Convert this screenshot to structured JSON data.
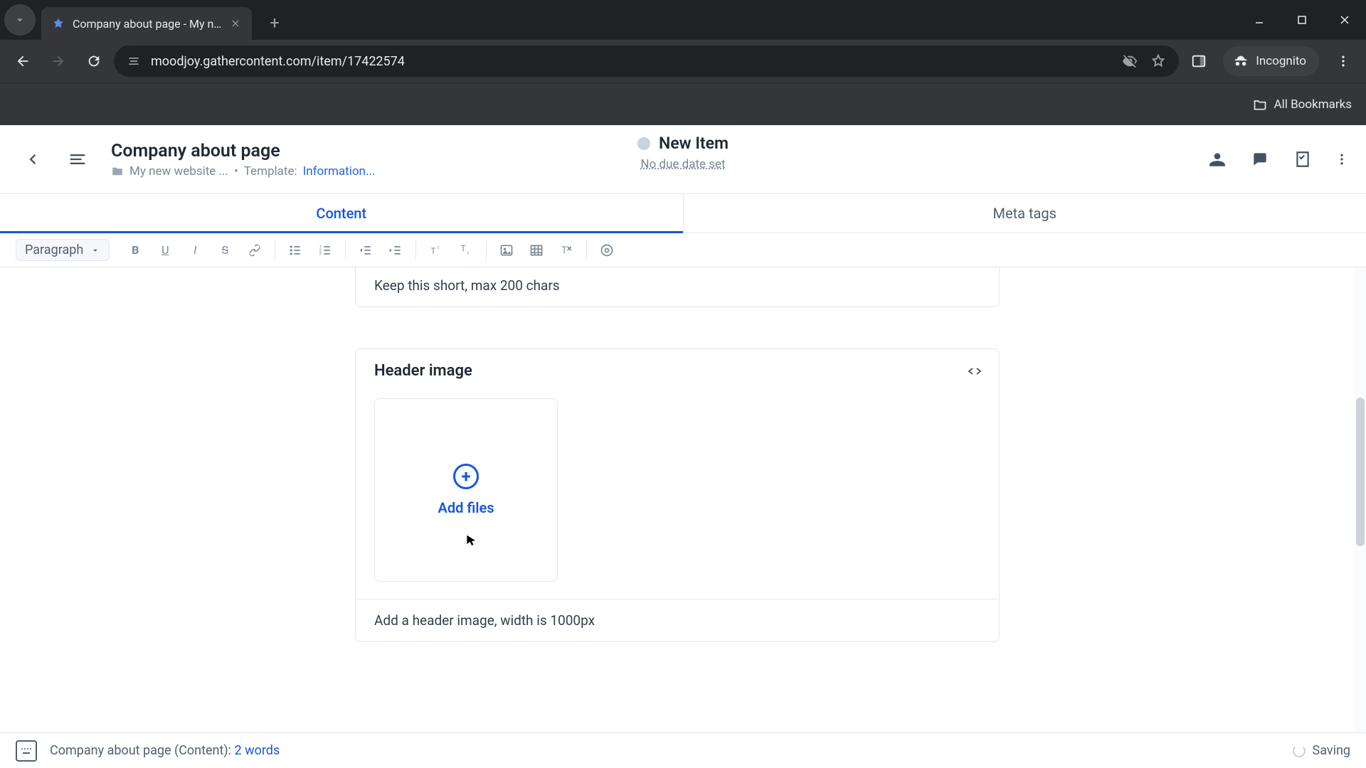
{
  "browser": {
    "tab_title": "Company about page - My ne…",
    "url": "moodjoy.gathercontent.com/item/17422574",
    "incognito_label": "Incognito",
    "all_bookmarks": "All Bookmarks"
  },
  "header": {
    "title": "Company about page",
    "breadcrumb_folder": "My new website ...",
    "breadcrumb_separator": "•",
    "template_prefix": "Template:",
    "template_name": "Information...",
    "status_label": "New Item",
    "due_date": "No due date set"
  },
  "tabs": {
    "content": "Content",
    "meta": "Meta tags"
  },
  "toolbar": {
    "format_label": "Paragraph"
  },
  "field_intro_helper": "Keep this short, max 200 chars",
  "header_image": {
    "title": "Header image",
    "add_files": "Add files",
    "helper": "Add a header image, width is 1000px"
  },
  "footer": {
    "context": "Company about page (Content): ",
    "word_count": "2 words",
    "saving": "Saving"
  }
}
